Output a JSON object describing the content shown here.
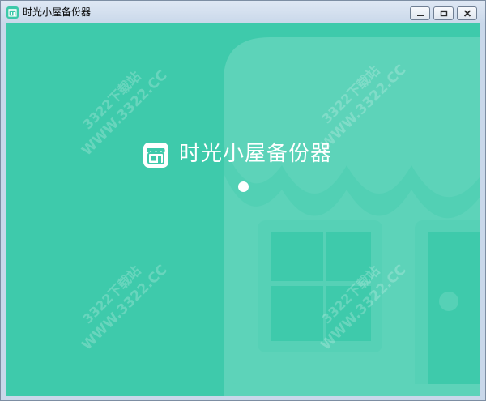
{
  "window": {
    "title": "时光小屋备份器",
    "controls": {
      "minimize": "minimize",
      "maximize": "maximize",
      "close": "close"
    }
  },
  "splash": {
    "app_name": "时光小屋备份器",
    "logo_icon": "shop-house-icon"
  },
  "watermark": {
    "line1": "3322下载站",
    "line2": "WWW.3322.CC"
  },
  "colors": {
    "background": "#3ecaab",
    "house_shape": "#5dd3b9",
    "text": "#ffffff"
  }
}
